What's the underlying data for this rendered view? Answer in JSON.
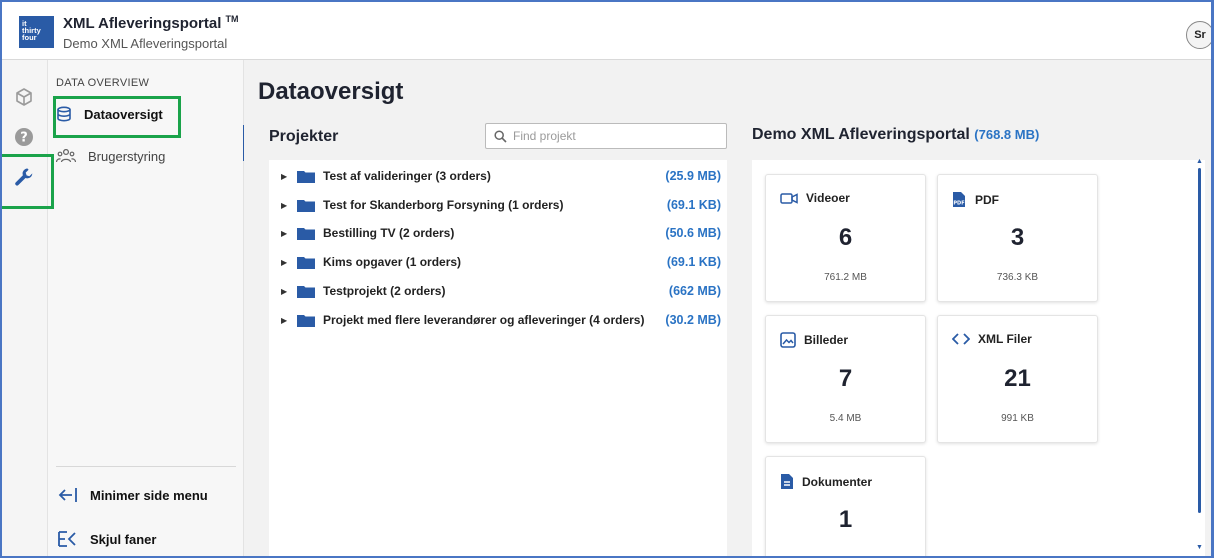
{
  "header": {
    "logo_lines": [
      "it",
      "thirty",
      "four"
    ],
    "app_title": "XML Afleveringsportal",
    "trademark": "TM",
    "subtitle": "Demo XML Afleveringsportal",
    "avatar_initials": "Sr"
  },
  "rail": {
    "icons": [
      "package-icon",
      "help-icon",
      "wrench-icon"
    ]
  },
  "sidebar": {
    "section_label": "DATA OVERVIEW",
    "items": [
      {
        "label": "Dataoversigt",
        "icon": "database-icon",
        "active": true
      },
      {
        "label": "Brugerstyring",
        "icon": "users-icon",
        "active": false
      }
    ],
    "bottom": {
      "minimize_label": "Minimer side menu",
      "hide_tabs_label": "Skjul faner"
    }
  },
  "main": {
    "page_title": "Dataoversigt",
    "projects": {
      "title": "Projekter",
      "search_placeholder": "Find projekt",
      "rows": [
        {
          "name": "Test af valideringer (3 orders)",
          "size": "(25.9 MB)"
        },
        {
          "name": "Test for Skanderborg Forsyning (1 orders)",
          "size": "(69.1 KB)"
        },
        {
          "name": "Bestilling TV (2 orders)",
          "size": "(50.6 MB)"
        },
        {
          "name": "Kims opgaver (1 orders)",
          "size": "(69.1 KB)"
        },
        {
          "name": "Testprojekt (2 orders)",
          "size": "(662 MB)"
        },
        {
          "name": "Projekt med flere leverandører og afleveringer (4 orders)",
          "size": "(30.2 MB)"
        }
      ]
    },
    "overview": {
      "title": "Demo XML Afleveringsportal",
      "total_size": "(768.8 MB)",
      "cards": [
        {
          "label": "Videoer",
          "icon": "video-icon",
          "count": "6",
          "size": "761.2 MB"
        },
        {
          "label": "PDF",
          "icon": "pdf-icon",
          "count": "3",
          "size": "736.3 KB"
        },
        {
          "label": "Billeder",
          "icon": "image-icon",
          "count": "7",
          "size": "5.4 MB"
        },
        {
          "label": "XML Filer",
          "icon": "code-icon",
          "count": "21",
          "size": "991 KB"
        },
        {
          "label": "Dokumenter",
          "icon": "document-icon",
          "count": "1",
          "size": ""
        }
      ]
    }
  },
  "colors": {
    "brand_blue": "#2a5ba6",
    "accent_blue": "#2a73c4",
    "highlight_green": "#1aa34a"
  }
}
